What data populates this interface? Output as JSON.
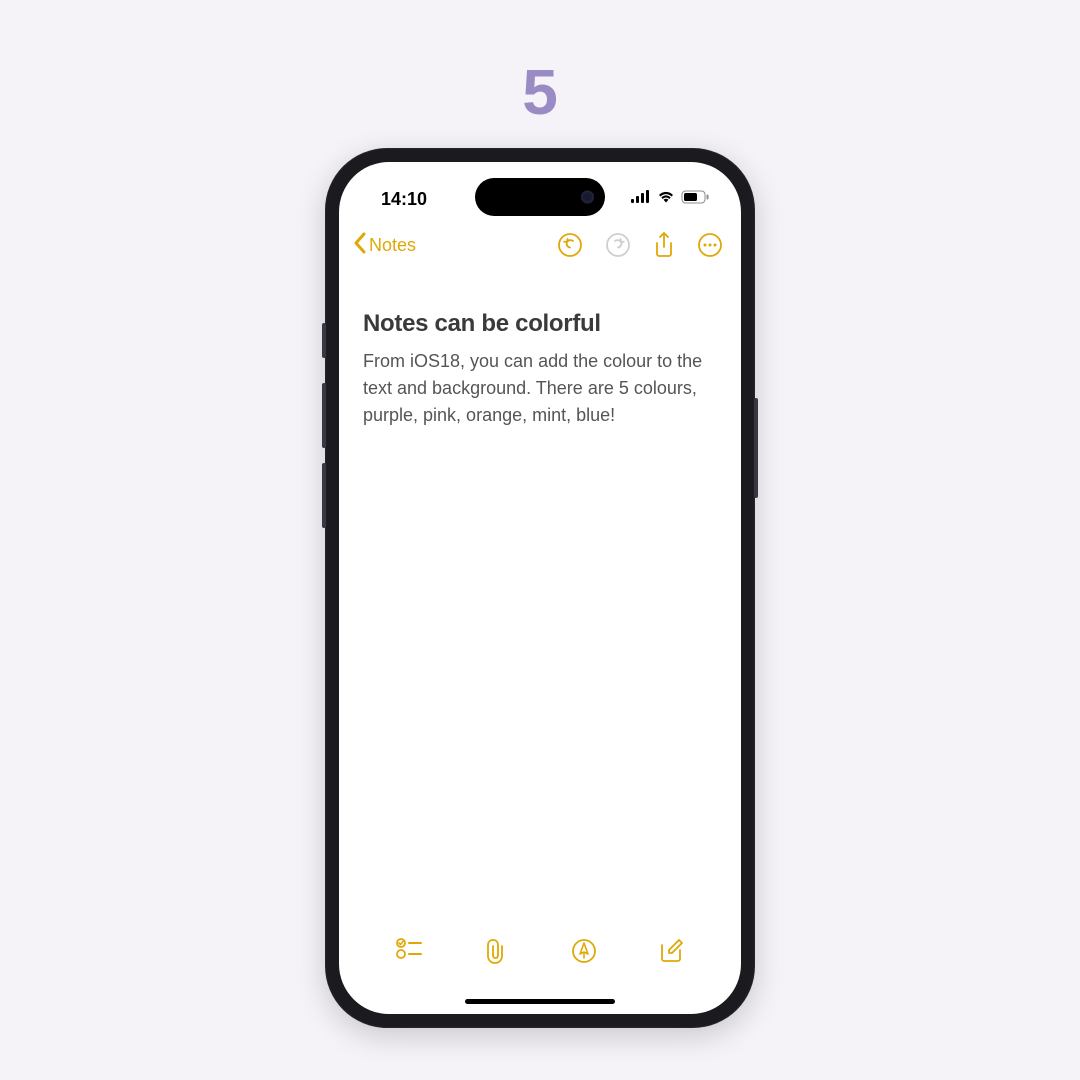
{
  "slide": {
    "number": "5"
  },
  "statusBar": {
    "time": "14:10"
  },
  "nav": {
    "backLabel": "Notes"
  },
  "note": {
    "title": "Notes can be colorful",
    "body": "From iOS18, you can add the colour to the text and background. There are 5 colours, purple, pink, orange, mint, blue!"
  },
  "colors": {
    "accent": "#e0a806",
    "disabled": "#cfcfcf"
  }
}
